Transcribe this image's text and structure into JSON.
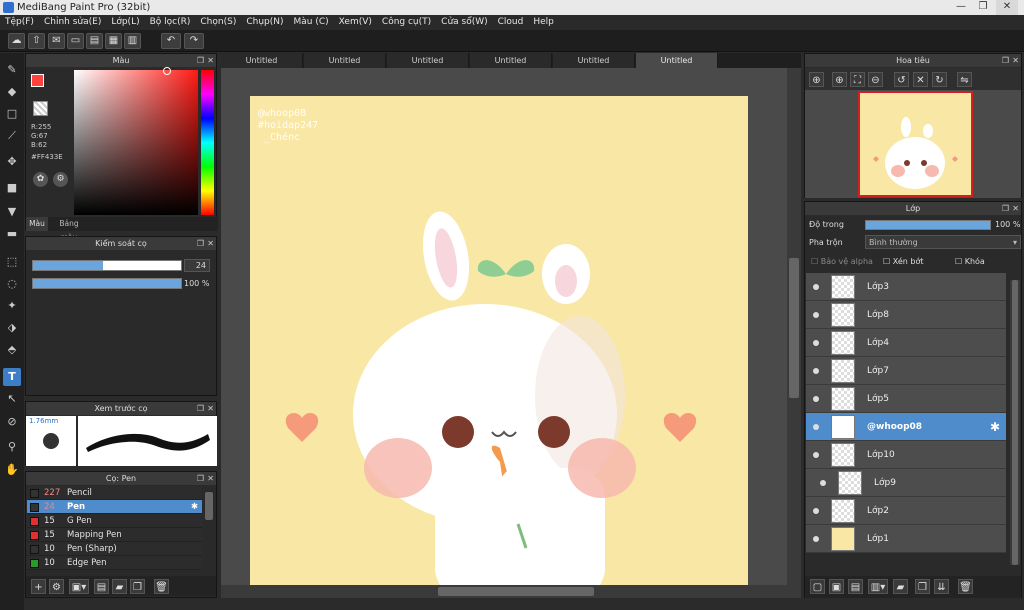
{
  "window": {
    "title": "MediBang Paint Pro (32bit)"
  },
  "menu": [
    "Tệp(F)",
    "Chỉnh sửa(E)",
    "Lớp(L)",
    "Bộ lọc(R)",
    "Chọn(S)",
    "Chụp(N)",
    "Màu (C)",
    "Xem(V)",
    "Công cụ(T)",
    "Cửa sổ(W)",
    "Cloud",
    "Help"
  ],
  "tabs": [
    "Untitled",
    "Untitled",
    "Untitled",
    "Untitled",
    "Untitled",
    "Untitled"
  ],
  "color_panel": {
    "title": "Màu",
    "r": "R:255",
    "g": "G:67",
    "b": "B:62",
    "hex": "#FF433E",
    "tab_color": "Màu",
    "tab_palette": "Bảng màu",
    "fg": "#ff433e"
  },
  "brush_control": {
    "title": "Kiểm soát cọ",
    "size": "24",
    "opacity": "100 %",
    "size_fraction": 0.47,
    "opacity_fraction": 1.0
  },
  "brush_preview": {
    "title": "Xem trước cọ",
    "size_label": "1.76mm"
  },
  "brush_list": {
    "title": "Cọ: Pen",
    "items": [
      {
        "size": "227",
        "name": "Pencil",
        "color": "#333333"
      },
      {
        "size": "24",
        "name": "Pen",
        "color": "#333333"
      },
      {
        "size": "15",
        "name": "G Pen",
        "color": "#e03030"
      },
      {
        "size": "15",
        "name": "Mapping Pen",
        "color": "#e03030"
      },
      {
        "size": "10",
        "name": "Pen (Sharp)",
        "color": "#333333"
      },
      {
        "size": "10",
        "name": "Edge Pen",
        "color": "#2a9a2a"
      }
    ]
  },
  "canvas": {
    "watermark_1": "@whoop08",
    "watermark_2": "#hoidap247",
    "watermark_3": "_Chénc"
  },
  "navigator": {
    "title": "Hoa tiêu"
  },
  "layer_panel": {
    "title": "Lớp",
    "opacity_label": "Độ trong",
    "opacity_value": "100 %",
    "blend_label": "Pha trộn",
    "blend_value": "Bình thường",
    "protect_alpha": "Bảo vệ alpha",
    "clipping": "Xén bớt",
    "lock": "Khóa",
    "layers": [
      "Lớp3",
      "Lớp8",
      "Lớp4",
      "Lớp7",
      "Lớp5",
      "@whoop08",
      "Lớp10",
      "Lớp9",
      "Lớp2",
      "Lớp1"
    ]
  },
  "colors": {
    "accent": "#4f8ccc",
    "canvas_bg": "#f9e7a6"
  }
}
